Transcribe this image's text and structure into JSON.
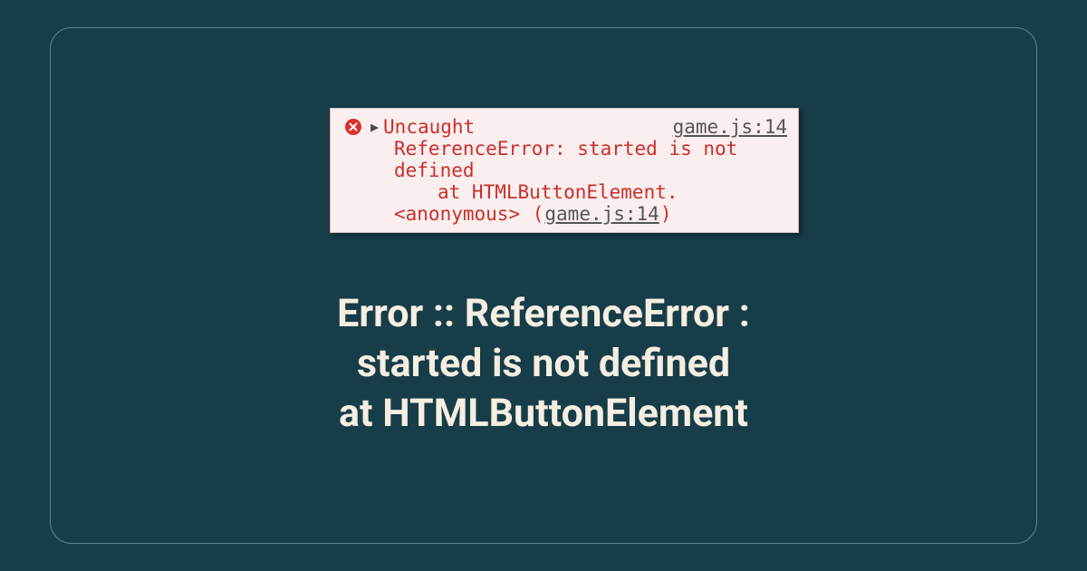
{
  "console": {
    "uncaught_label": "Uncaught",
    "source_right": "game.js:14",
    "message_line1": "ReferenceError: started is not",
    "message_line2": "defined",
    "trace_line": "at HTMLButtonElement.",
    "anon_label": "<anonymous>",
    "paren_open": "(",
    "source_inline": "game.js:14",
    "paren_close": ")"
  },
  "headline": {
    "line1": "Error :: ReferenceError :",
    "line2": "started is not defined",
    "line3": "at HTMLButtonElement"
  }
}
